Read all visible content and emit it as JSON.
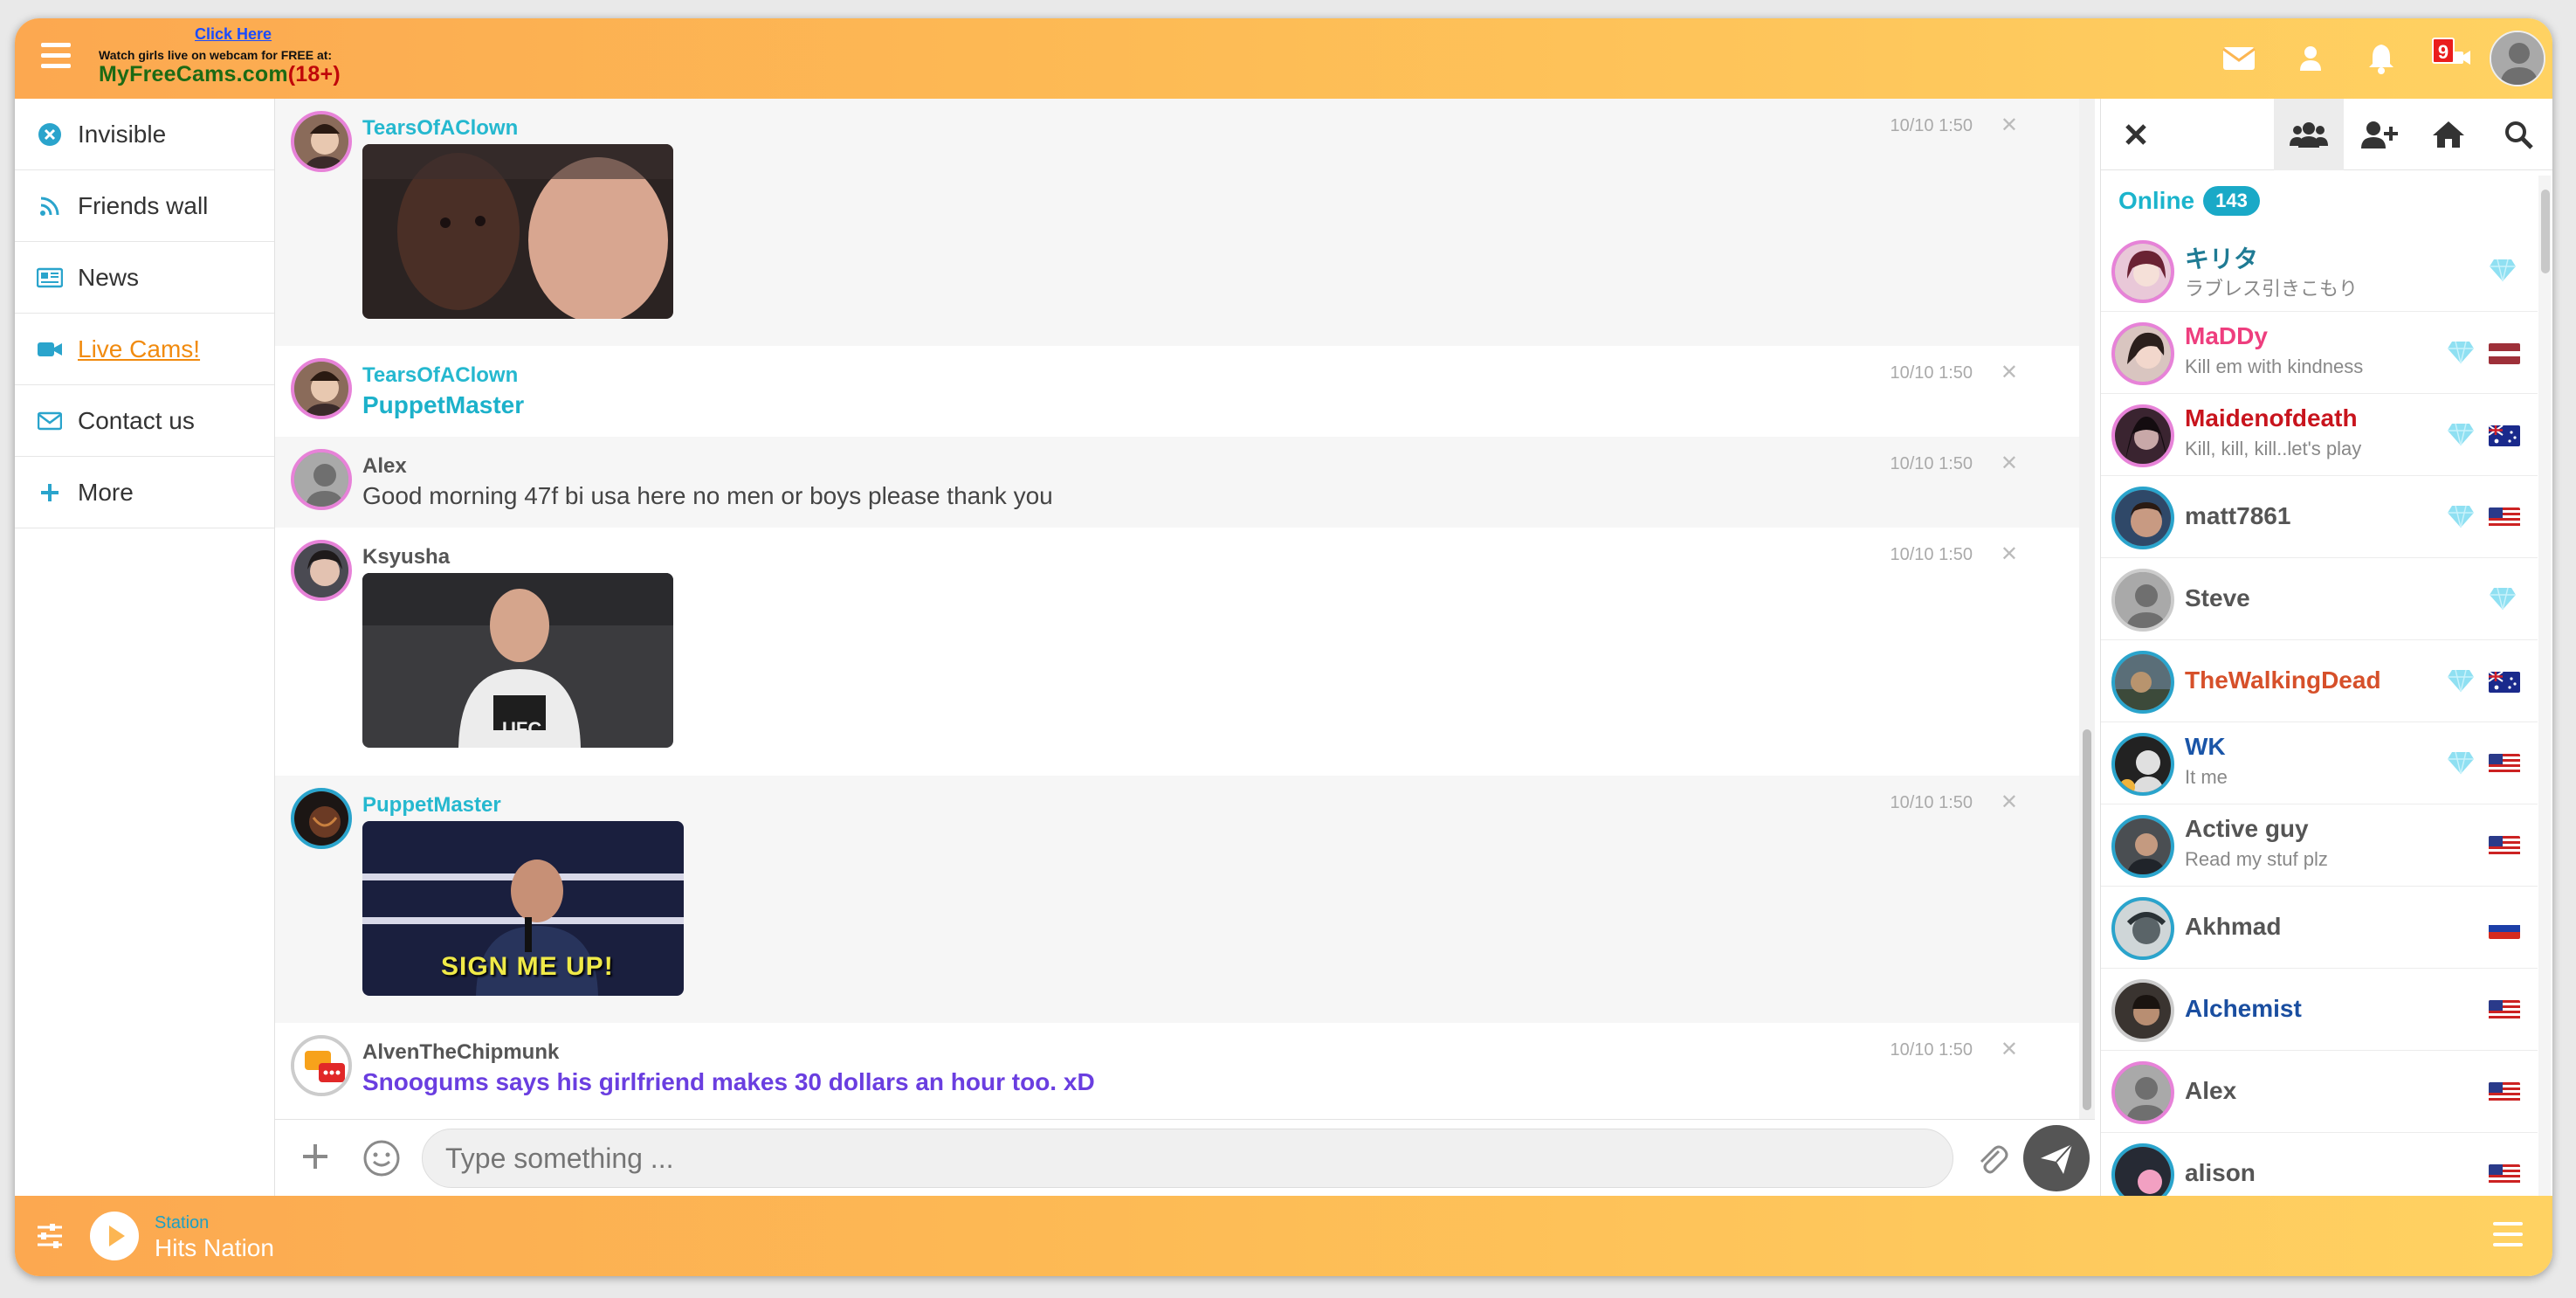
{
  "ad": {
    "click_here": "Click Here",
    "tagline": "Watch girls live on webcam for FREE at:",
    "brand": "MyFreeCams.com",
    "brand_suffix": "(18+)"
  },
  "header": {
    "notification_count": "9",
    "colors": {
      "gradient_start": "#fca850",
      "gradient_end": "#ffd262",
      "accent": "#1bb4cc"
    }
  },
  "nav": {
    "items": [
      {
        "label": "Invisible",
        "icon": "x-circle-icon"
      },
      {
        "label": "Friends wall",
        "icon": "rss-icon"
      },
      {
        "label": "News",
        "icon": "newspaper-icon"
      },
      {
        "label": "Live Cams!",
        "icon": "video-camera-icon"
      },
      {
        "label": "Contact us",
        "icon": "envelope-icon"
      },
      {
        "label": "More",
        "icon": "plus-icon"
      }
    ]
  },
  "messages": [
    {
      "user": "TearsOfAClown",
      "time": "10/10 1:50",
      "type": "image"
    },
    {
      "user": "TearsOfAClown",
      "time": "10/10 1:50",
      "text": "PuppetMaster"
    },
    {
      "user": "Alex",
      "time": "10/10 1:50",
      "text": "Good morning 47f bi usa here no men or boys please thank you"
    },
    {
      "user": "Ksyusha",
      "time": "10/10 1:50",
      "type": "image"
    },
    {
      "user": "PuppetMaster",
      "time": "10/10 1:50",
      "type": "image",
      "caption": "SIGN ME UP!"
    },
    {
      "user": "AlvenTheChipmunk",
      "time": "10/10 1:50",
      "text": "Snoogums says his girlfriend makes 30 dollars an hour too. xD"
    }
  ],
  "input": {
    "placeholder": "Type something ..."
  },
  "online": {
    "label": "Online",
    "count": "143",
    "users": [
      {
        "name": "キリタ",
        "status": "ラブレス引きこもり",
        "color": "#1f7b94"
      },
      {
        "name": "MaDDy",
        "status": "Kill em with kindness",
        "color": "#ee3e7e",
        "flag": "latvia"
      },
      {
        "name": "Maidenofdeath",
        "status": "Kill, kill, kill..let's play",
        "color": "#c8141d",
        "flag": "australia"
      },
      {
        "name": "matt7861",
        "status": "",
        "color": "#555555",
        "flag": "usa"
      },
      {
        "name": "Steve",
        "status": "",
        "color": "#555555"
      },
      {
        "name": "TheWalkingDead",
        "status": "",
        "color": "#d6502a",
        "flag": "australia"
      },
      {
        "name": "WK",
        "status": "It me",
        "color": "#1a55a8",
        "flag": "usa"
      },
      {
        "name": "Active guy",
        "status": "Read my stuf plz",
        "color": "#555555",
        "flag": "usa"
      },
      {
        "name": "Akhmad",
        "status": "",
        "color": "#555555",
        "flag": "russia"
      },
      {
        "name": "Alchemist",
        "status": "",
        "color": "#1a4ea0",
        "flag": "usa"
      },
      {
        "name": "Alex",
        "status": "",
        "color": "#555555",
        "flag": "usa"
      },
      {
        "name": "alison",
        "status": "",
        "color": "#555555",
        "flag": "usa"
      }
    ]
  },
  "player": {
    "station_label": "Station",
    "station_name": "Hits Nation"
  }
}
